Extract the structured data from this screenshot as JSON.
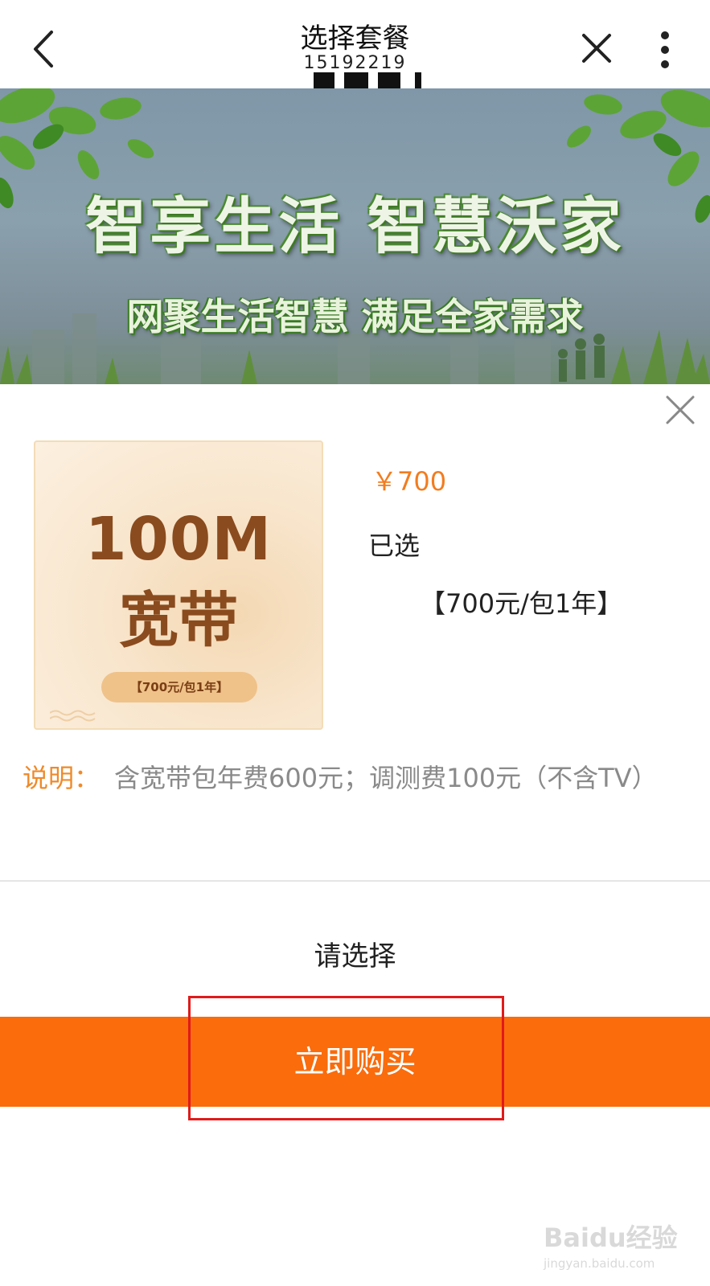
{
  "header": {
    "title": "选择套餐",
    "masked_number": "15192219"
  },
  "banner": {
    "title": "智享生活 智慧沃家",
    "subtitle": "网聚生活智慧 满足全家需求"
  },
  "product": {
    "card_main": "100M",
    "card_sub": "宽带",
    "card_pill": "【700元/包1年】",
    "price": "￥700",
    "selected_label": "已选",
    "selected_value": "【700元/包1年】",
    "desc_label": "说明：",
    "desc_text": "含宽带包年费600元；调测费100元（不含TV）"
  },
  "footer": {
    "choose_prompt": "请选择",
    "buy_label": "立即购买"
  },
  "watermark": {
    "text": "Baidu经验",
    "url": "jingyan.baidu.com"
  },
  "colors": {
    "accent": "#fa6c0c",
    "price": "#f27c1f",
    "highlight": "#e01b1b",
    "card_text": "#8a4b1e"
  }
}
